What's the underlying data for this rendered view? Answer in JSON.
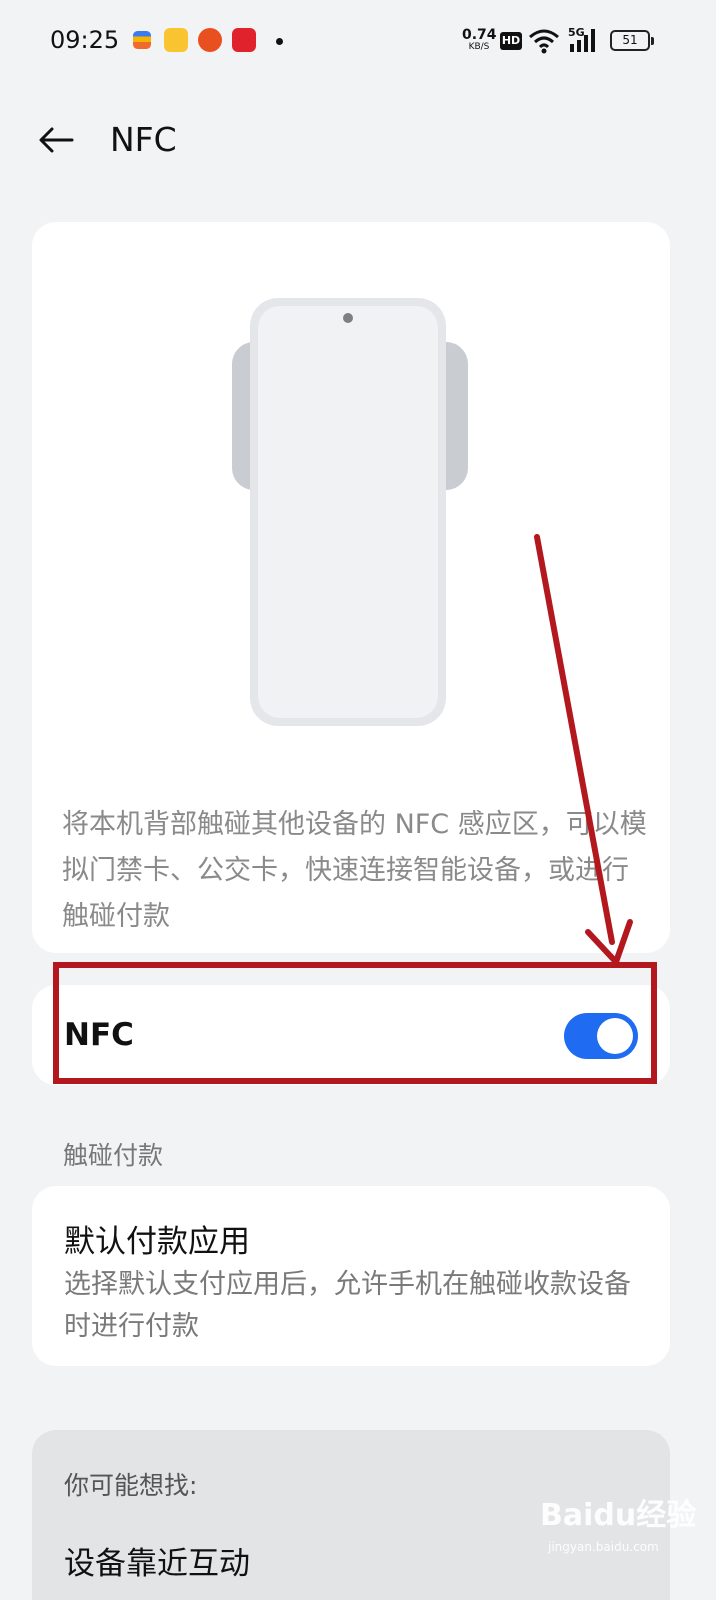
{
  "status_bar": {
    "time": "09:25",
    "net_speed_value": "0.74",
    "net_speed_unit": "KB/S",
    "hd": "HD",
    "network": "5G",
    "battery": "51",
    "icons": [
      "wallet-app-icon",
      "vpn-app-icon",
      "taobao-app-icon",
      "pinduoduo-app-icon",
      "notification-dot-icon",
      "wifi-icon",
      "signal-icon",
      "battery-icon"
    ]
  },
  "header": {
    "title": "NFC",
    "back_icon": "back-arrow-icon"
  },
  "hero": {
    "description": "将本机背部触碰其他设备的 NFC 感应区，可以模拟门禁卡、公交卡，快速连接智能设备，或进行触碰付款"
  },
  "nfc_toggle": {
    "label": "NFC",
    "state": "on",
    "accent": "#1f6bf2"
  },
  "touch_pay": {
    "section_label": "触碰付款",
    "title": "默认付款应用",
    "description": "选择默认支付应用后，允许手机在触碰收款设备时进行付款"
  },
  "suggestions": {
    "heading": "你可能想找:",
    "items": [
      "设备靠近互动"
    ]
  },
  "annotation": {
    "color": "#b3181e"
  },
  "watermark": {
    "text": "Baidu经验",
    "sub": "jingyan.baidu.com"
  }
}
